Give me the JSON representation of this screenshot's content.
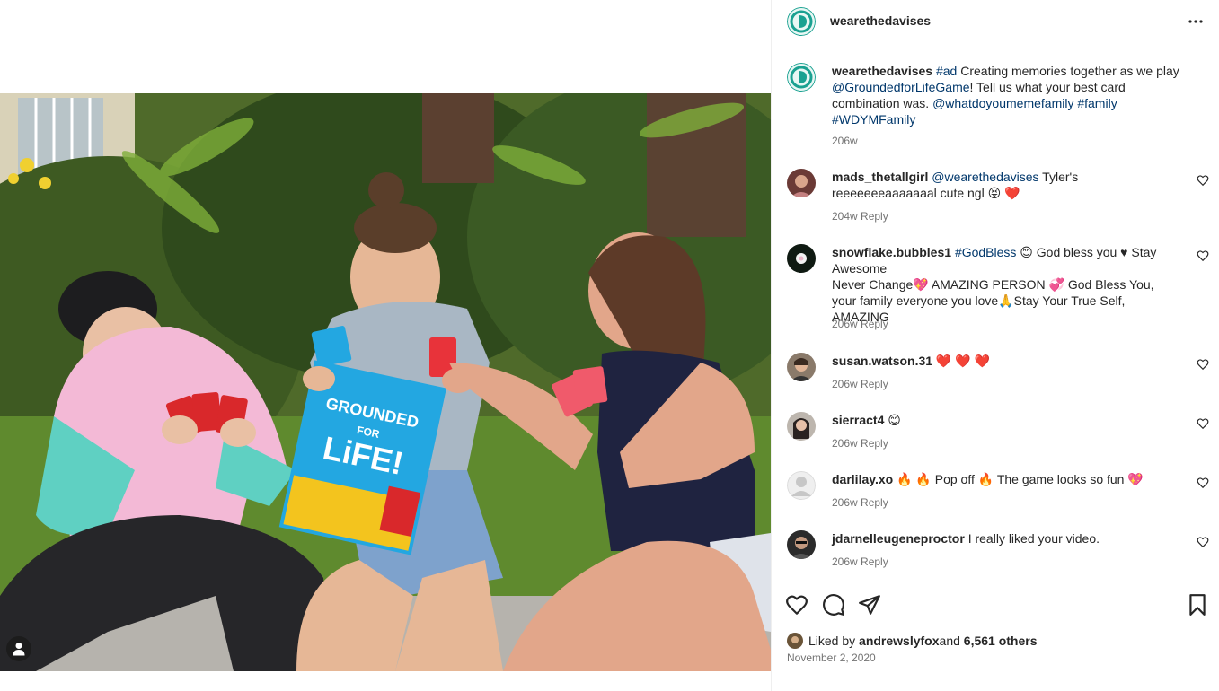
{
  "post": {
    "username": "wearethedavises",
    "caption": {
      "tag_ad": "#ad",
      "text1": " Creating memories together as we play ",
      "mention_game": "@GroundedforLifeGame",
      "text2": "! Tell us what your best card combination was. ",
      "mention_wdym": "@whatdoyoumemefamily",
      "tag_family": "#family",
      "tag_wdym": "#WDYMFamily",
      "time": "206w"
    },
    "product_box": {
      "line1": "GROUNDED",
      "line2": "FOR",
      "line3": "LiFE!",
      "card_text": "GROUNDED FOR LiFE!"
    }
  },
  "comments": [
    {
      "username": "mads_thetallgirl",
      "mention": "@wearethedavises",
      "text": " Tyler's reeeeeeeaaaaaaal cute ngl 😝 ❤️",
      "time": "204w",
      "reply": "Reply"
    },
    {
      "username": "snowflake.bubbles1",
      "mention": "#GodBless",
      "text": " 😊 God bless you ♥ Stay Awesome",
      "line2": "Never Change💖 AMAZING PERSON 💞 God Bless You, your family everyone you love🙏Stay Your True Self, AMAZING",
      "time": "206w",
      "reply": "Reply"
    },
    {
      "username": "susan.watson.31",
      "text": " ❤️ ❤️ ❤️",
      "time": "206w",
      "reply": "Reply"
    },
    {
      "username": "sierract4",
      "text": " 😊",
      "time": "206w",
      "reply": "Reply"
    },
    {
      "username": "darlilay.xo",
      "text": " 🔥 🔥 Pop off 🔥 The game looks so fun 💖",
      "time": "206w",
      "reply": "Reply"
    },
    {
      "username": "jdarnelleugeneproctor",
      "text": " I really liked your video.",
      "time": "206w",
      "reply": "Reply"
    }
  ],
  "likes": {
    "prefix": "Liked by ",
    "user": "andrewslyfox",
    "middle": " and ",
    "count": "6,561 others"
  },
  "date": "November 2, 2020",
  "icons": {
    "more": "more-options-icon",
    "like": "heart-icon",
    "comment": "comment-icon",
    "share": "send-icon",
    "save": "bookmark-icon",
    "user_tag": "user-icon"
  },
  "colors": {
    "link": "#00376b",
    "meta": "#737373",
    "text": "#262626",
    "logo_teal": "#1aa191"
  }
}
